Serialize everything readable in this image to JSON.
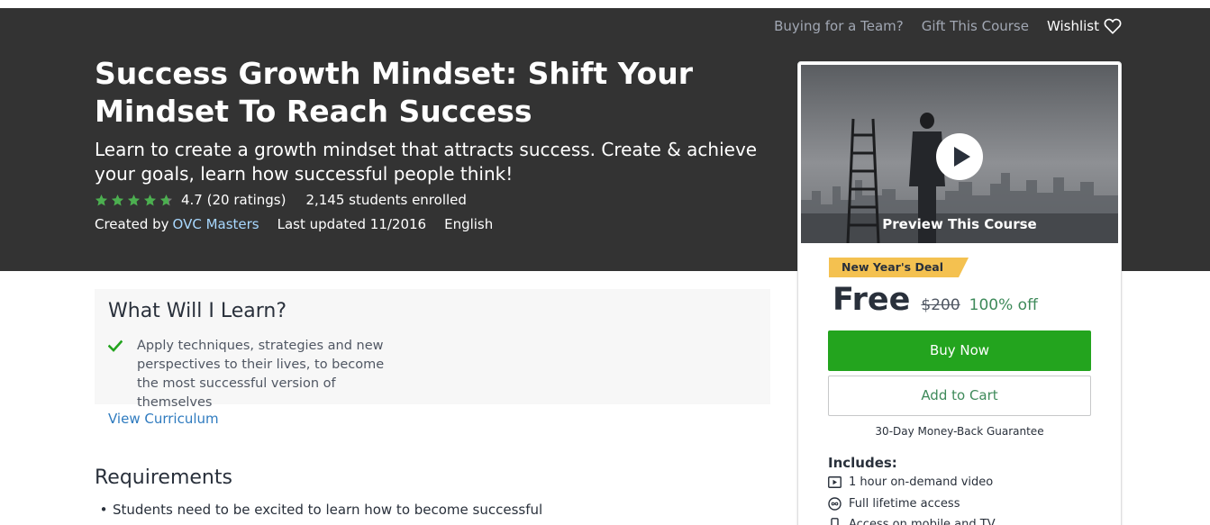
{
  "topnav": {
    "team": "Buying for a Team?",
    "gift": "Gift This Course",
    "wishlist": "Wishlist"
  },
  "course": {
    "title": "Success Growth Mindset: Shift Your Mindset To Reach Success",
    "subtitle": "Learn to create a growth mindset that attracts success. Create & achieve your goals, learn how successful people think!",
    "rating_text": "4.7 (20 ratings)",
    "rating_stars": 4.7,
    "enrolled": "2,145 students enrolled",
    "created_by_label": "Created by",
    "author": "OVC Masters",
    "last_updated": "Last updated 11/2016",
    "language": "English"
  },
  "learn": {
    "heading": "What Will I Learn?",
    "items": [
      "Apply techniques, strategies and new perspectives to their lives, to become the most successful version of themselves"
    ],
    "view_curriculum": "View Curriculum"
  },
  "requirements": {
    "heading": "Requirements",
    "items": [
      "Students need to be excited to learn how to become successful"
    ]
  },
  "sidebar": {
    "preview_label": "Preview This Course",
    "deal_badge": "New Year's Deal",
    "price_now": "Free",
    "price_old": "$200",
    "price_off": "100% off",
    "buy_now": "Buy Now",
    "add_to_cart": "Add to Cart",
    "guarantee": "30-Day Money-Back Guarantee",
    "includes_title": "Includes:",
    "includes": [
      "1 hour on-demand video",
      "Full lifetime access",
      "Access on mobile and TV"
    ]
  },
  "colors": {
    "hero_bg": "#333333",
    "buy_green": "#23a41e",
    "deal_yellow": "#f4c150",
    "link_blue": "#2f7bbf",
    "star_green": "#4caf50"
  }
}
